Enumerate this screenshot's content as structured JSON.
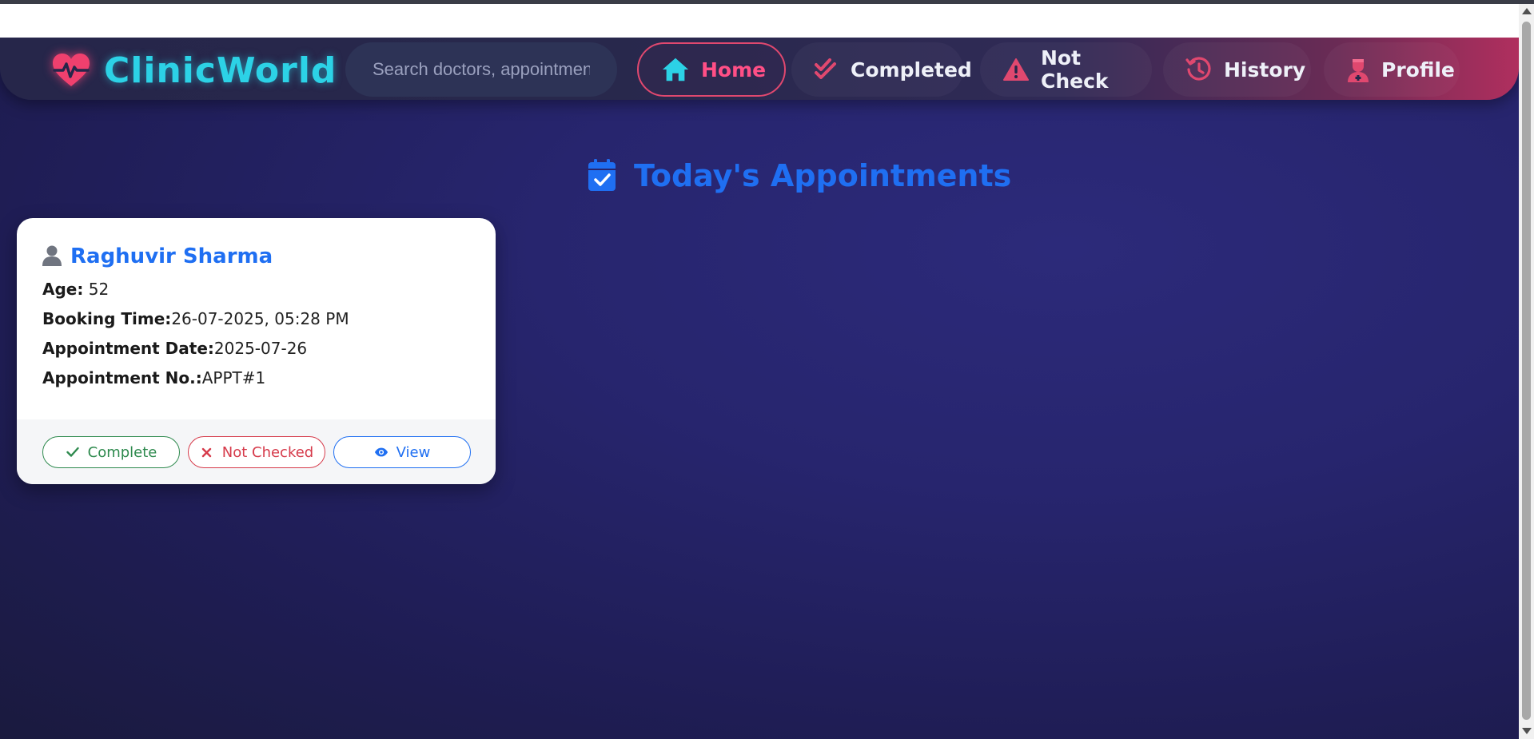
{
  "app": {
    "brand": "ClinicWorld",
    "colors": {
      "brand_cyan": "#2cd2e6",
      "brand_pink": "#ff4f86",
      "accent_blue": "#1f6ff2",
      "success_green": "#2e8a4e",
      "danger_red": "#d63a4a"
    }
  },
  "search": {
    "placeholder": "Search doctors, appointments..."
  },
  "nav": {
    "items": [
      {
        "label": "Home",
        "icon": "home-icon",
        "active": true
      },
      {
        "label": "Completed",
        "icon": "double-check-icon",
        "active": false
      },
      {
        "label": "Not Check",
        "icon": "warning-icon",
        "active": false
      },
      {
        "label": "History",
        "icon": "history-icon",
        "active": false
      },
      {
        "label": "Profile",
        "icon": "user-doctor-icon",
        "active": false
      }
    ]
  },
  "main": {
    "heading": "Today's Appointments",
    "heading_icon": "calendar-check-icon"
  },
  "appointments": [
    {
      "name": "Raghuvir Sharma",
      "age_label": "Age:",
      "age": "52",
      "booking_label": "Booking Time:",
      "booking_time": "26-07-2025, 05:28 PM",
      "date_label": "Appointment Date:",
      "date": "2025-07-26",
      "number_label": "Appointment No.:",
      "number": "APPT#1",
      "actions": {
        "complete": "Complete",
        "not_checked": "Not Checked",
        "view": "View"
      }
    }
  ]
}
